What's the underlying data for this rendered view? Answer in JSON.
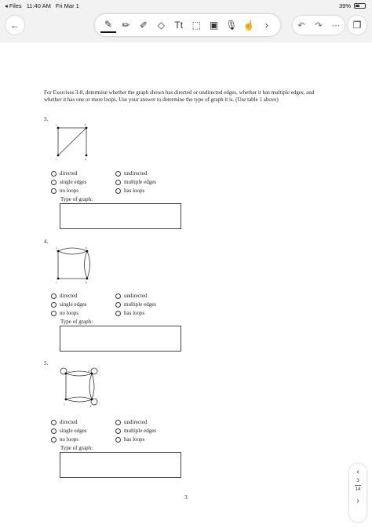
{
  "status_bar": {
    "back_app": "◂ Files",
    "time": "11:40 AM",
    "date": "Fri Mar 1",
    "battery": "39%"
  },
  "toolbar": {
    "back_icon": "←",
    "tools": [
      {
        "name": "pen-icon",
        "glyph": "✎"
      },
      {
        "name": "pencil-icon",
        "glyph": "✏"
      },
      {
        "name": "highlighter-icon",
        "glyph": "✐"
      },
      {
        "name": "eraser-icon",
        "glyph": "◇"
      },
      {
        "name": "text-icon",
        "glyph": "Tt"
      },
      {
        "name": "lasso-icon",
        "glyph": "⬚"
      },
      {
        "name": "image-icon",
        "glyph": "▣"
      },
      {
        "name": "mic-icon",
        "glyph": "🎙"
      },
      {
        "name": "touch-icon",
        "glyph": "☝"
      },
      {
        "name": "more-tools-icon",
        "glyph": "›"
      }
    ],
    "undo_icon": "↶",
    "redo_icon": "↷",
    "more_icon": "⋯",
    "pages_icon": "❐"
  },
  "document": {
    "intro": "For Exercises 3-8, determine whether the graph shown has directed or undirected edges, whether it has multiple edges, and whether it has one or more loops. Use your answer to determine the type of graph it is. (Use table 1 above)",
    "exercises": [
      {
        "number": "3.",
        "nodes": {
          "a": "a",
          "b": "b",
          "c": "c",
          "d": "d"
        },
        "options": {
          "directed": "directed",
          "undirected": "undirected",
          "single": "single edges",
          "multiple": "multiple edges",
          "noloops": "no loops",
          "hasloops": "has loops"
        },
        "type_label": "Type of graph:"
      },
      {
        "number": "4.",
        "nodes": {
          "a": "a",
          "b": "b",
          "c": "c",
          "d": "d"
        },
        "options": {
          "directed": "directed",
          "undirected": "undirected",
          "single": "single edges",
          "multiple": "multiple edges",
          "noloops": "no loops",
          "hasloops": "has loops"
        },
        "type_label": "Type of graph:"
      },
      {
        "number": "5.",
        "nodes": {
          "a": "a",
          "b": "b",
          "c": "c",
          "d": "d"
        },
        "options": {
          "directed": "directed",
          "undirected": "undirected",
          "single": "single edges",
          "multiple": "multiple edges",
          "noloops": "no loops",
          "hasloops": "has loops"
        },
        "type_label": "Type of graph:"
      }
    ],
    "page_number": "3"
  },
  "navigator": {
    "up_icon": "‹",
    "current": "3",
    "total": "14",
    "down_icon": "›"
  }
}
